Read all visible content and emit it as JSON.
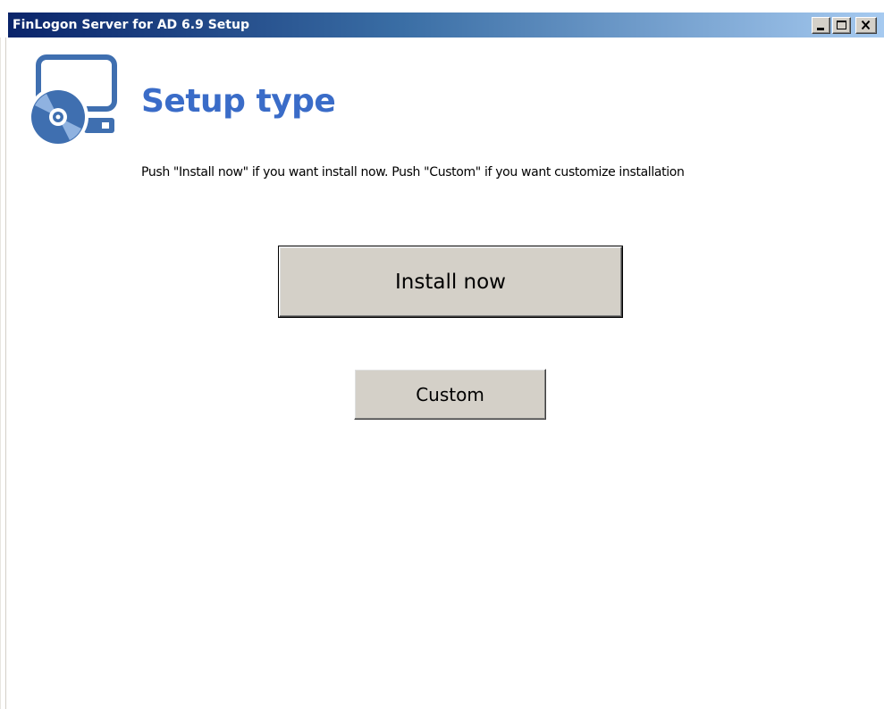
{
  "window": {
    "title": "FinLogon Server for AD 6.9 Setup"
  },
  "titlebar_buttons": {
    "minimize_icon": "minimize-icon",
    "maximize_icon": "maximize-icon",
    "close_icon": "close-icon"
  },
  "header": {
    "icon": "monitor-disc-icon",
    "title": "Setup type",
    "accent_color": "#3a6cc8"
  },
  "instruction": "Push \"Install now\" if you want install now. Push \"Custom\" if you want customize installation",
  "actions": {
    "install_label": "Install now",
    "custom_label": "Custom"
  },
  "colors": {
    "button_face": "#d4d0c8",
    "titlebar_start": "#0a246a",
    "titlebar_end": "#a6caf0"
  }
}
